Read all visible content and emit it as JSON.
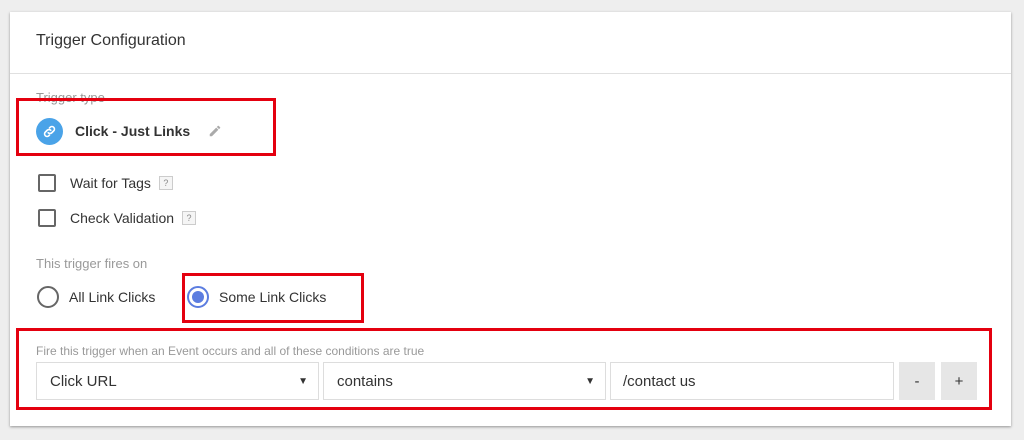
{
  "card": {
    "title": "Trigger Configuration"
  },
  "trigger_type": {
    "label": "Trigger type",
    "name": "Click - Just Links",
    "icon": "link-icon",
    "icon_color": "#4aa3e8"
  },
  "options": [
    {
      "label": "Wait for Tags",
      "checked": false,
      "help": "?"
    },
    {
      "label": "Check Validation",
      "checked": false,
      "help": "?"
    }
  ],
  "fires_on": {
    "label": "This trigger fires on",
    "choices": [
      {
        "label": "All Link Clicks",
        "selected": false
      },
      {
        "label": "Some Link Clicks",
        "selected": true
      }
    ],
    "accent_color": "#5c7de0"
  },
  "conditions": {
    "label": "Fire this trigger when an Event occurs and all of these conditions are true",
    "variable": "Click URL",
    "operator": "contains",
    "value": "/contact us",
    "remove_label": "-",
    "add_label": "+"
  },
  "annotation_color": "#e4000f"
}
